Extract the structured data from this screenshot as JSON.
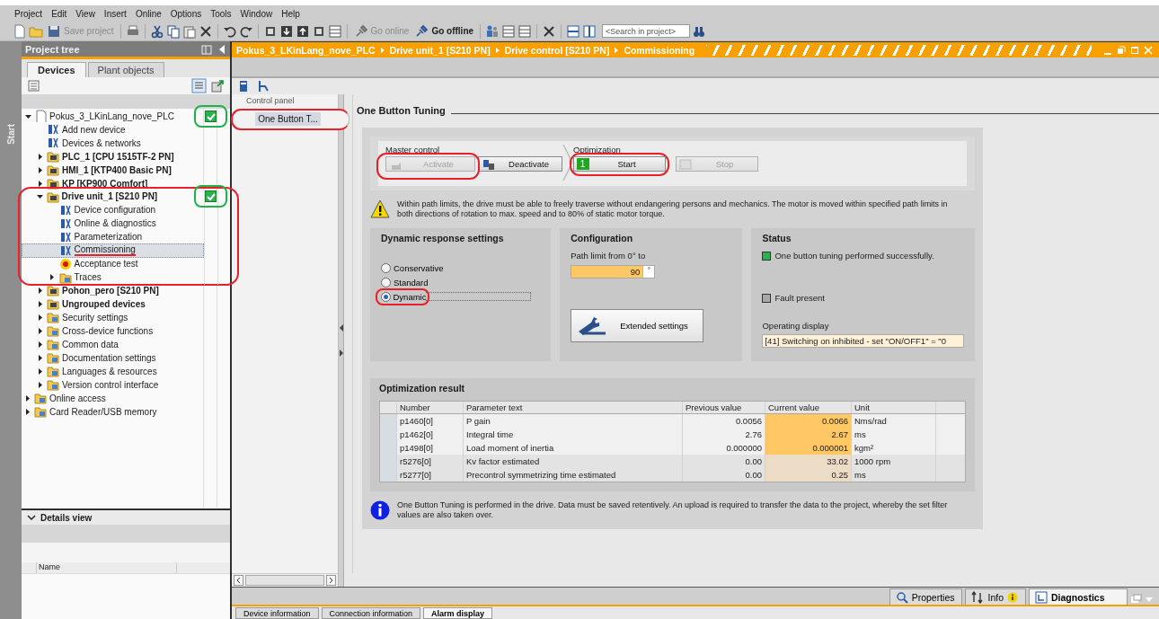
{
  "menu": [
    "Project",
    "Edit",
    "View",
    "Insert",
    "Online",
    "Options",
    "Tools",
    "Window",
    "Help"
  ],
  "toolbar": {
    "buttons": [
      {
        "label": "Save project",
        "disabled": true
      },
      {
        "label": "Go online",
        "disabled": true
      },
      {
        "label": "Go offline",
        "disabled": false
      }
    ],
    "search": {
      "placeholder": "<Search in project>"
    }
  },
  "start_tab": "Start",
  "project_tree": {
    "title": "Project tree",
    "tabs": [
      {
        "label": "Devices",
        "selected": true
      },
      {
        "label": "Plant objects",
        "selected": false
      }
    ],
    "items": [
      {
        "label": "Pokus_3_LKinLang_nove_PLC",
        "kind": "project",
        "expanded": true,
        "selected": false,
        "online_ok": true,
        "check_circled": true,
        "children": [
          {
            "label": "Add new device",
            "kind": "item",
            "selected": false
          },
          {
            "label": "Devices & networks",
            "kind": "item",
            "selected": false
          },
          {
            "label": "PLC_1 [CPU 1515TF-2 PN]",
            "kind": "device",
            "expanded": false,
            "selected": false
          },
          {
            "label": "HMI_1 [KTP400 Basic PN]",
            "kind": "device",
            "expanded": false,
            "selected": false
          },
          {
            "label": "KP [KP900 Comfort]",
            "kind": "device",
            "expanded": false,
            "selected": false
          },
          {
            "label": "Drive unit_1 [S210 PN]",
            "kind": "device",
            "expanded": true,
            "selected": false,
            "online_ok": true,
            "check_circled": true,
            "circled": true,
            "children": [
              {
                "label": "Device configuration",
                "kind": "item",
                "selected": false
              },
              {
                "label": "Online & diagnostics",
                "kind": "item",
                "selected": false
              },
              {
                "label": "Parameterization",
                "kind": "item",
                "selected": false
              },
              {
                "label": "Commissioning",
                "kind": "item",
                "selected": true,
                "underlined": true
              },
              {
                "label": "Acceptance test",
                "kind": "test",
                "selected": false
              },
              {
                "label": "Traces",
                "kind": "folder",
                "expanded": false,
                "selected": false
              }
            ]
          },
          {
            "label": "Pohon_pero [S210 PN]",
            "kind": "device",
            "expanded": false,
            "selected": false
          },
          {
            "label": "Ungrouped devices",
            "kind": "device",
            "expanded": false,
            "selected": false
          },
          {
            "label": "Security settings",
            "kind": "folder",
            "expanded": false,
            "selected": false
          },
          {
            "label": "Cross-device functions",
            "kind": "folder",
            "expanded": false,
            "selected": false
          },
          {
            "label": "Common data",
            "kind": "folder",
            "expanded": false,
            "selected": false
          },
          {
            "label": "Documentation settings",
            "kind": "folder",
            "expanded": false,
            "selected": false
          },
          {
            "label": "Languages & resources",
            "kind": "folder",
            "expanded": false,
            "selected": false
          },
          {
            "label": "Version control interface",
            "kind": "folder",
            "expanded": false,
            "selected": false
          }
        ]
      },
      {
        "label": "Online access",
        "kind": "folder",
        "expanded": false,
        "selected": false
      },
      {
        "label": "Card Reader/USB memory",
        "kind": "folder",
        "expanded": false,
        "selected": false
      }
    ]
  },
  "details_view": {
    "title": "Details view",
    "columns": [
      "Name"
    ]
  },
  "breadcrumb": [
    "Pokus_3_LKinLang_nove_PLC",
    "Drive unit_1 [S210 PN]",
    "Drive control [S210 PN]",
    "Commissioning"
  ],
  "nav": {
    "title": "Control panel",
    "items": [
      {
        "label": "One Button T...",
        "selected": true,
        "circled": true
      }
    ]
  },
  "tuning": {
    "title": "One Button Tuning",
    "master_control": {
      "label": "Master control",
      "buttons": [
        {
          "label": "Activate",
          "disabled": true,
          "circled": true
        },
        {
          "label": "Deactivate",
          "disabled": false
        }
      ]
    },
    "optimization": {
      "label": "Optimization",
      "buttons": [
        {
          "label": "Start",
          "disabled": false,
          "step": "1",
          "circled": true
        },
        {
          "label": "Stop",
          "disabled": true
        }
      ]
    },
    "warning": "Within path limits, the drive must be able to freely traverse without endangering persons and mechanics. The motor is moved within specified path limits in both directions of rotation to max. speed and to 80% of static motor torque.",
    "dynamic_response": {
      "title": "Dynamic response settings",
      "options": [
        {
          "label": "Conservative",
          "selected": false
        },
        {
          "label": "Standard",
          "selected": false
        },
        {
          "label": "Dynamic",
          "selected": true,
          "circled": true
        }
      ]
    },
    "configuration": {
      "title": "Configuration",
      "path_limit_label": "Path limit from 0° to",
      "path_limit_value": "90",
      "path_limit_unit": "°",
      "extended_settings": "Extended settings"
    },
    "status": {
      "title": "Status",
      "indicators": [
        {
          "label": "One button tuning performed successfully.",
          "on": true
        },
        {
          "label": "Fault present",
          "on": false
        }
      ],
      "operating_display_label": "Operating display",
      "operating_display": "[41] Switching on inhibited - set \"ON/OFF1\" = \"0"
    },
    "result": {
      "title": "Optimization result",
      "columns": [
        "Number",
        "Parameter text",
        "Previous value",
        "Current value",
        "Unit"
      ],
      "rows": [
        {
          "kind": "editable",
          "cells": [
            "p1460[0]",
            "P gain",
            "0.0056",
            "0.0066",
            "Nms/rad"
          ]
        },
        {
          "kind": "editable",
          "cells": [
            "p1462[0]",
            "Integral time",
            "2.76",
            "2.67",
            "ms"
          ]
        },
        {
          "kind": "editable",
          "cells": [
            "p1498[0]",
            "Load moment of inertia",
            "0.000000",
            "0.000001",
            "kgm²"
          ]
        },
        {
          "kind": "readonly",
          "cells": [
            "r5276[0]",
            "Kv factor estimated",
            "0.00",
            "33.02",
            "1000 rpm"
          ]
        },
        {
          "kind": "readonly",
          "cells": [
            "r5277[0]",
            "Precontrol symmetrizing time estimated",
            "0.00",
            "0.25",
            "ms"
          ]
        }
      ]
    },
    "info": "One Button Tuning is performed in the drive. Data must be saved retentively. An upload is required to transfer the data to the project, whereby the set filter values are also taken over."
  },
  "inspector_tabs": [
    {
      "label": "Properties",
      "selected": false
    },
    {
      "label": "Info",
      "selected": false
    },
    {
      "label": "Diagnostics",
      "selected": true
    }
  ],
  "bottom_tabs": [
    {
      "label": "Device information",
      "selected": false
    },
    {
      "label": "Connection information",
      "selected": false
    },
    {
      "label": "Alarm display",
      "selected": true
    }
  ]
}
